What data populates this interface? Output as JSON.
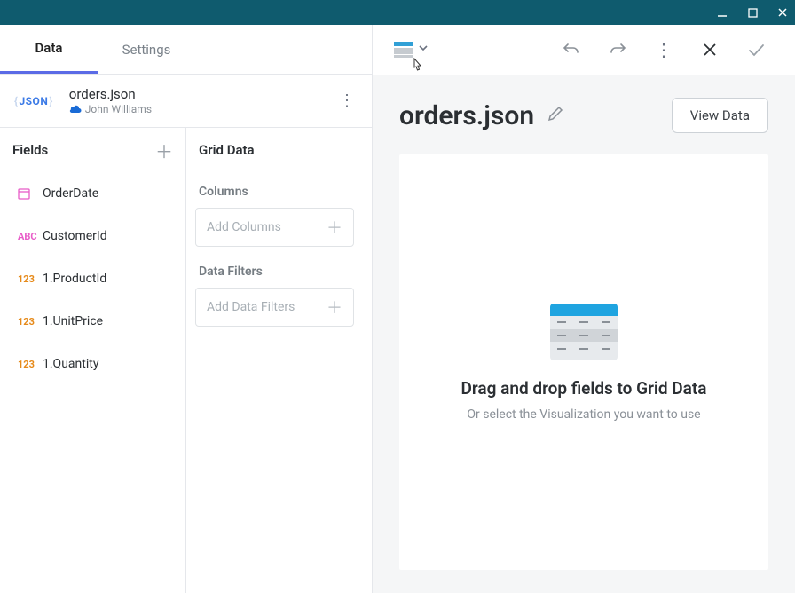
{
  "tabs": {
    "data": "Data",
    "settings": "Settings"
  },
  "datasource": {
    "filename": "orders.json",
    "owner": "John Williams"
  },
  "fields": {
    "header": "Fields",
    "items": [
      {
        "icon": "date",
        "label": "OrderDate"
      },
      {
        "icon": "abc",
        "label": "CustomerId"
      },
      {
        "icon": "num",
        "label": "1.ProductId"
      },
      {
        "icon": "num",
        "label": "1.UnitPrice"
      },
      {
        "icon": "num",
        "label": "1.Quantity"
      }
    ]
  },
  "grid": {
    "header": "Grid Data",
    "columns_label": "Columns",
    "columns_placeholder": "Add Columns",
    "filters_label": "Data Filters",
    "filters_placeholder": "Add Data Filters"
  },
  "right": {
    "title": "orders.json",
    "view_data": "View Data",
    "dz_title": "Drag and drop fields to Grid Data",
    "dz_sub": "Or select the Visualization you want to use"
  }
}
